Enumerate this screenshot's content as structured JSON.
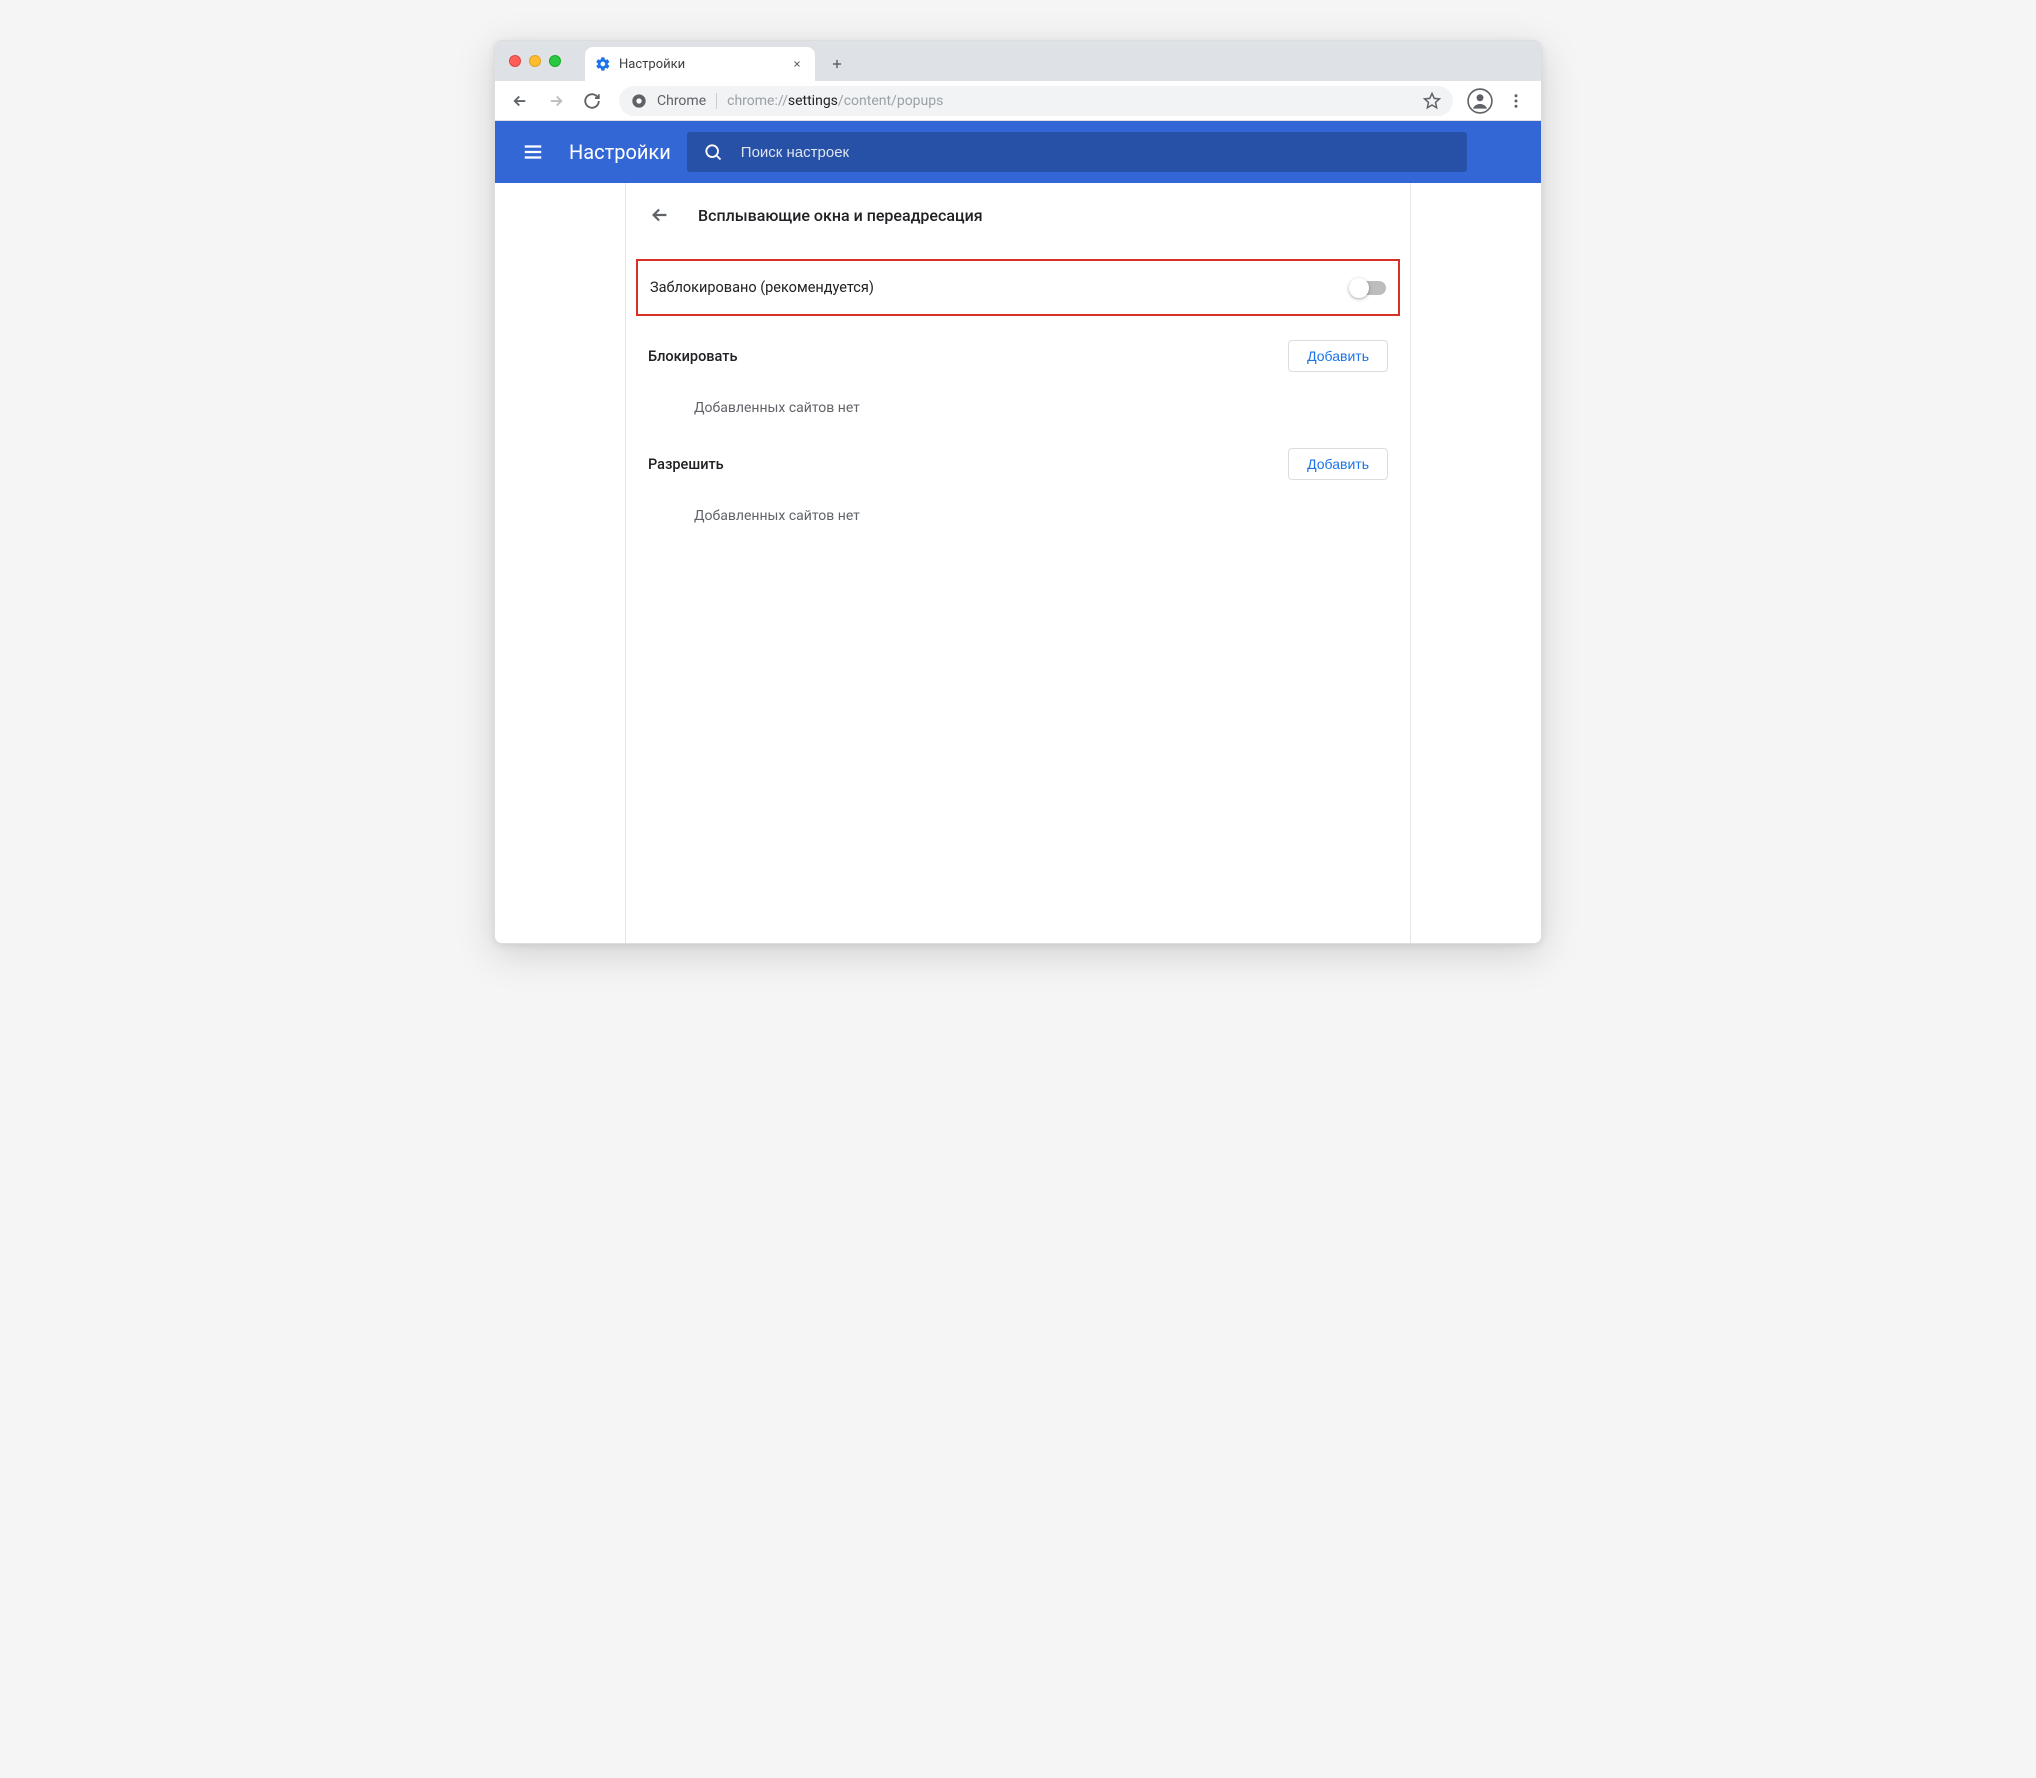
{
  "tab": {
    "title": "Настройки"
  },
  "omnibox": {
    "label": "Chrome",
    "url_prefix": "chrome://",
    "url_bold": "settings",
    "url_suffix": "/content/popups"
  },
  "header": {
    "title": "Настройки",
    "search_placeholder": "Поиск настроек"
  },
  "page": {
    "title": "Всплывающие окна и переадресация",
    "toggle_label": "Заблокировано (рекомендуется)"
  },
  "sections": {
    "block": {
      "title": "Блокировать",
      "add_label": "Добавить",
      "empty": "Добавленных сайтов нет"
    },
    "allow": {
      "title": "Разрешить",
      "add_label": "Добавить",
      "empty": "Добавленных сайтов нет"
    }
  }
}
